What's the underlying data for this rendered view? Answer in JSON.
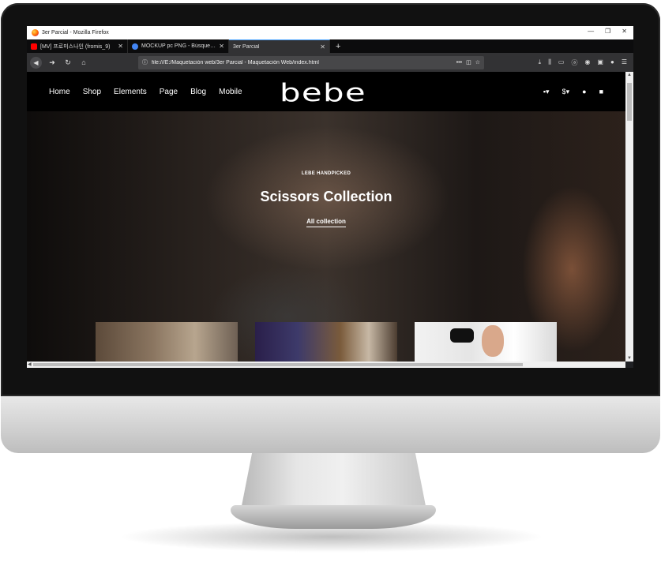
{
  "window": {
    "title": "3er Parcial - Mozilla Firefox",
    "controls": [
      "—",
      "❐",
      "✕"
    ]
  },
  "tabs": [
    {
      "label": "[MV] 프로미스나인 (fromis_9)",
      "close": "✕",
      "favicon_color": "#ff0000"
    },
    {
      "label": "MOCKUP pc PNG - Búsqueda de",
      "close": "✕",
      "favicon_color": "#4285f4"
    },
    {
      "label": "3er Parcial",
      "close": "✕",
      "active": true
    }
  ],
  "new_tab_label": "+",
  "navbar": {
    "url": "file:///E:/Maquetación web/3er Parcial - Maquetación Web/index.html",
    "url_actions": "•••"
  },
  "site": {
    "menu": [
      "Home",
      "Shop",
      "Elements",
      "Page",
      "Blog",
      "Mobile"
    ],
    "logo": "bebe",
    "currency": "$"
  },
  "hero": {
    "eyebrow": "LEBE HANDPICKED",
    "title": "Scissors Collection",
    "link": "All collection"
  },
  "colors": {
    "accent": "#45a1ff",
    "page_bg": "#000000",
    "tab_bar": "#0c0c0d",
    "toolbar": "#323234"
  }
}
